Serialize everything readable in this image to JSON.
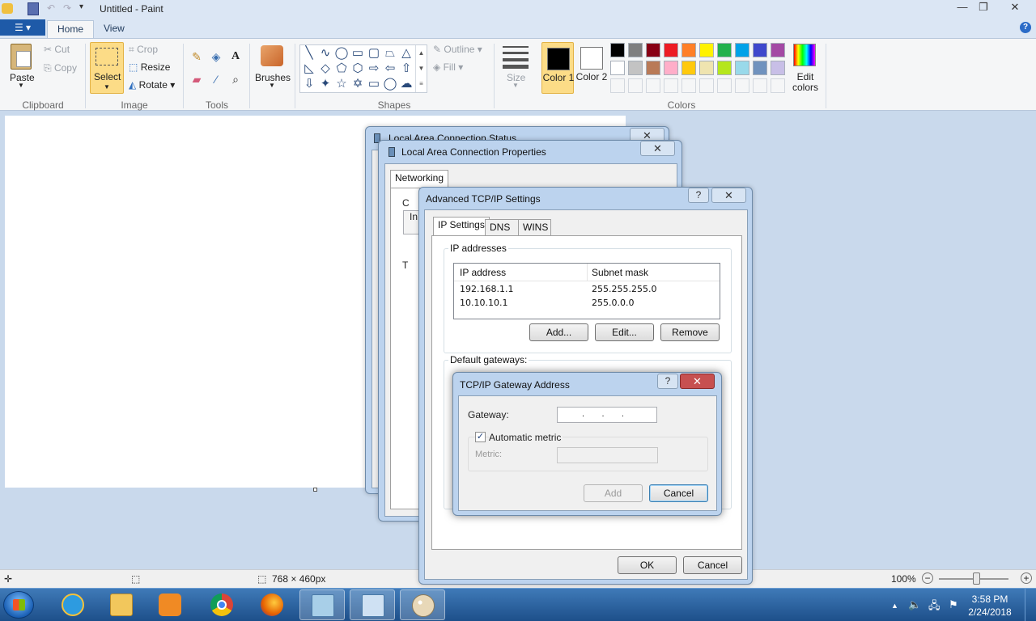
{
  "paint": {
    "title": "Untitled - Paint",
    "file_menu": "☰ ▾",
    "tabs": [
      "Home",
      "View"
    ],
    "clipboard": {
      "paste": "Paste",
      "cut": "Cut",
      "copy": "Copy",
      "group": "Clipboard"
    },
    "image": {
      "select": "Select",
      "crop": "Crop",
      "resize": "Resize",
      "rotate": "Rotate",
      "group": "Image"
    },
    "tools": {
      "group": "Tools"
    },
    "brushes": "Brushes",
    "shapes": {
      "outline": "Outline",
      "fill": "Fill",
      "group": "Shapes"
    },
    "size": "Size",
    "color1": "Color 1",
    "color2": "Color 2",
    "edit_colors": "Edit colors",
    "colors_group": "Colors",
    "palette_row1": [
      "#000000",
      "#7f7f7f",
      "#880015",
      "#ed1c24",
      "#ff7f27",
      "#fff200",
      "#22b14c",
      "#00a2e8",
      "#3f48cc",
      "#a349a4"
    ],
    "palette_row2": [
      "#ffffff",
      "#c3c3c3",
      "#b97a57",
      "#ffaec9",
      "#ffc90e",
      "#efe4b0",
      "#b5e61d",
      "#99d9ea",
      "#7092be",
      "#c8bfe7"
    ],
    "status": {
      "dimensions": "768 × 460px",
      "zoom": "100%"
    }
  },
  "status_dialog": {
    "title": "Local Area Connection Status"
  },
  "properties_dialog": {
    "title": "Local Area Connection Properties",
    "tab": "Networking",
    "frag_c": "C",
    "frag_in": "In",
    "frag_t": "T"
  },
  "advanced_dialog": {
    "title": "Advanced TCP/IP Settings",
    "tabs": [
      "IP Settings",
      "DNS",
      "WINS"
    ],
    "ip_group": "IP addresses",
    "columns": [
      "IP address",
      "Subnet mask"
    ],
    "rows": [
      {
        "ip": "192.168.1.1",
        "mask": "255.255.255.0"
      },
      {
        "ip": "10.10.10.1",
        "mask": "255.0.0.0"
      }
    ],
    "add": "Add...",
    "edit": "Edit...",
    "remove": "Remove",
    "gateways_group": "Default gateways:",
    "ok": "OK",
    "cancel": "Cancel"
  },
  "gateway_dialog": {
    "title": "TCP/IP Gateway Address",
    "gateway_label": "Gateway:",
    "gateway_value": ".       .       .",
    "auto_metric": "Automatic metric",
    "metric_label": "Metric:",
    "add": "Add",
    "cancel": "Cancel"
  },
  "taskbar": {
    "time": "3:58 PM",
    "date": "2/24/2018"
  }
}
